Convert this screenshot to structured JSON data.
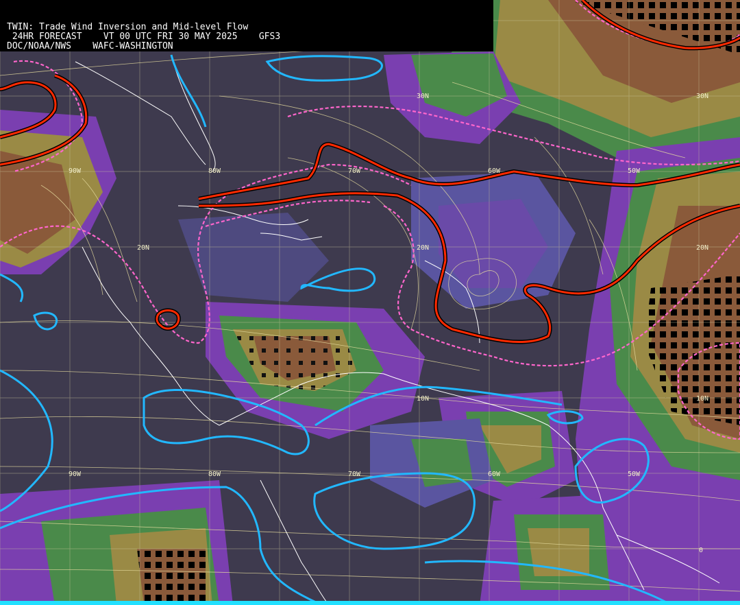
{
  "header": {
    "line1": "TWIN: Trade Wind Inversion and Mid-level Flow",
    "line2": " 24HR FORECAST    VT 00 UTC FRI 30 MAY 2025    GFS3",
    "line3": "DOC/NOAA/NWS    WAFC-WASHINGTON"
  },
  "grid_labels": {
    "lat": [
      {
        "text": "30N",
        "id": "lat-30n-a"
      },
      {
        "text": "30N",
        "id": "lat-30n-b"
      },
      {
        "text": "20N",
        "id": "lat-20n-a"
      },
      {
        "text": "20N",
        "id": "lat-20n-b"
      },
      {
        "text": "20N",
        "id": "lat-20n-c"
      },
      {
        "text": "10N",
        "id": "lat-10n-a"
      },
      {
        "text": "10N",
        "id": "lat-10n-b"
      },
      {
        "text": "0",
        "id": "lat-0"
      }
    ],
    "lon": [
      {
        "text": "90W",
        "id": "lon-90w-a"
      },
      {
        "text": "80W",
        "id": "lon-80w-a"
      },
      {
        "text": "70W",
        "id": "lon-70w-a"
      },
      {
        "text": "60W",
        "id": "lon-60w-a"
      },
      {
        "text": "50W",
        "id": "lon-50w-a"
      },
      {
        "text": "90W",
        "id": "lon-90w-b"
      },
      {
        "text": "80W",
        "id": "lon-80w-b"
      },
      {
        "text": "70W",
        "id": "lon-70w-b"
      },
      {
        "text": "60W",
        "id": "lon-60w-b"
      },
      {
        "text": "50W",
        "id": "lon-50w-b"
      }
    ]
  },
  "colors": {
    "background": "#3e3a4e",
    "purple": "#7a3fb0",
    "slate": "#5a55a0",
    "green": "#4a8a4a",
    "olive": "#9a8a45",
    "brown": "#8a5a3a",
    "inversion_line": "#ff2a00",
    "dashed_line": "#ff66cc",
    "cyan_line": "#22b8ff",
    "streamline": "#e8dea0",
    "coastline": "#ffffff",
    "grid": "#c9c39a"
  }
}
